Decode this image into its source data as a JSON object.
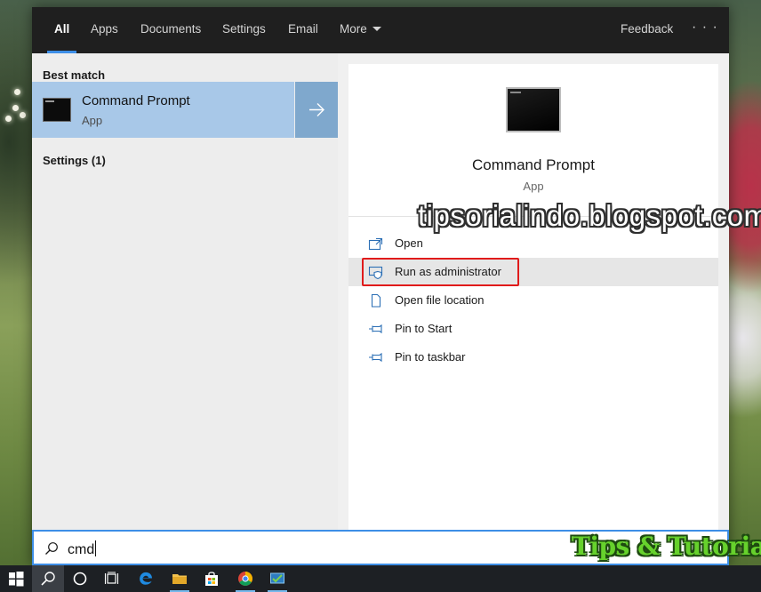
{
  "window": {
    "title": "Windows Search"
  },
  "tabs": [
    {
      "label": "All",
      "active": true
    },
    {
      "label": "Apps"
    },
    {
      "label": "Documents"
    },
    {
      "label": "Settings"
    },
    {
      "label": "Email"
    },
    {
      "label": "More"
    }
  ],
  "topbar": {
    "feedback_label": "Feedback",
    "overflow_icon": "more-horizontal-icon"
  },
  "results": {
    "best_match_heading": "Best match",
    "best_match": {
      "title": "Command Prompt",
      "subtitle": "App",
      "icon": "terminal-icon",
      "open_arrow_icon": "arrow-right-icon"
    },
    "settings_heading": "Settings (1)"
  },
  "preview": {
    "title": "Command Prompt",
    "subtitle": "App",
    "actions": [
      {
        "label": "Open",
        "icon": "open-icon"
      },
      {
        "label": "Run as administrator",
        "icon": "shield-admin-icon",
        "highlighted": true
      },
      {
        "label": "Open file location",
        "icon": "file-icon"
      },
      {
        "label": "Pin to Start",
        "icon": "pin-icon"
      },
      {
        "label": "Pin to taskbar",
        "icon": "pin-icon"
      }
    ]
  },
  "search": {
    "query": "cmd",
    "icon": "search-icon"
  },
  "overlays": {
    "watermark": "tipsorialindo.blogspot.com",
    "logo": "Tips & Tutorial"
  },
  "taskbar": {
    "items": [
      {
        "icon": "windows-start-icon"
      },
      {
        "icon": "search-icon",
        "active": true
      },
      {
        "icon": "cortana-icon"
      },
      {
        "icon": "task-view-icon"
      },
      {
        "icon": "edge-icon"
      },
      {
        "icon": "file-explorer-icon",
        "running": true
      },
      {
        "icon": "store-icon"
      },
      {
        "icon": "chrome-icon",
        "running": true
      },
      {
        "icon": "app-icon",
        "running": true
      }
    ]
  },
  "colors": {
    "accent": "#3d8ee6",
    "selection": "#a8c8e8",
    "highlight_border": "#e01b1b",
    "topbar": "#1f1f1f",
    "taskbar": "#1d2024"
  }
}
